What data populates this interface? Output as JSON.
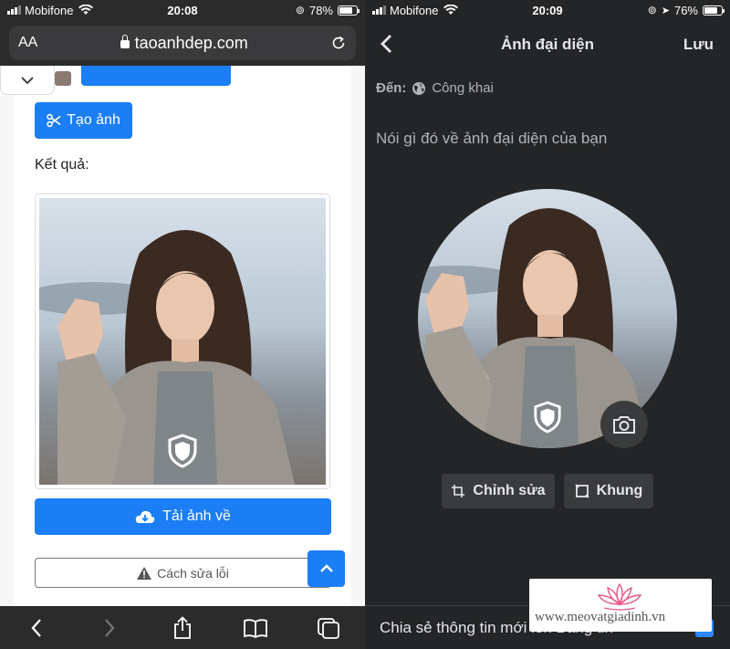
{
  "left": {
    "status": {
      "carrier": "Mobifone",
      "time": "20:08",
      "battery": "78%",
      "battery_level": 0.78
    },
    "browser": {
      "text_size_label": "AA",
      "host": "taoanhdep.com"
    },
    "page": {
      "create_button": "Tạo ảnh",
      "result_label": "Kết quả:",
      "download_button": "Tải ảnh về",
      "fix_button": "Cách sửa lỗi"
    }
  },
  "right": {
    "status": {
      "carrier": "Mobifone",
      "time": "20:09",
      "battery": "76%",
      "battery_level": 0.76
    },
    "header": {
      "title": "Ảnh đại diện",
      "save": "Lưu"
    },
    "audience": {
      "label": "Đến:",
      "value": "Công khai"
    },
    "caption_placeholder": "Nói gì đó về ảnh đại diện của bạn",
    "edit_button": "Chỉnh sửa",
    "frame_button": "Khung",
    "share_label": "Chia sẻ thông tin mới lên Bảng tin"
  },
  "watermark": {
    "text": "www.meovatgiadinh.vn"
  },
  "colors": {
    "safari_blue": "#1c7ef4",
    "fb_dark": "#242526",
    "fb_gray_button": "#3a3b3c",
    "fb_blue": "#2d88ff",
    "lotus_pink": "#e85a8a"
  },
  "icons": [
    "signal-icon",
    "wifi-icon",
    "battery-icon",
    "lock-icon",
    "reload-icon",
    "scissors-icon",
    "cloud-download-icon",
    "warning-icon",
    "chevron-up-icon",
    "back-icon",
    "forward-icon",
    "share-icon",
    "bookmarks-icon",
    "tabs-icon",
    "globe-icon",
    "camera-icon",
    "crop-icon",
    "frame-icon",
    "shield-icon",
    "lotus-logo"
  ]
}
